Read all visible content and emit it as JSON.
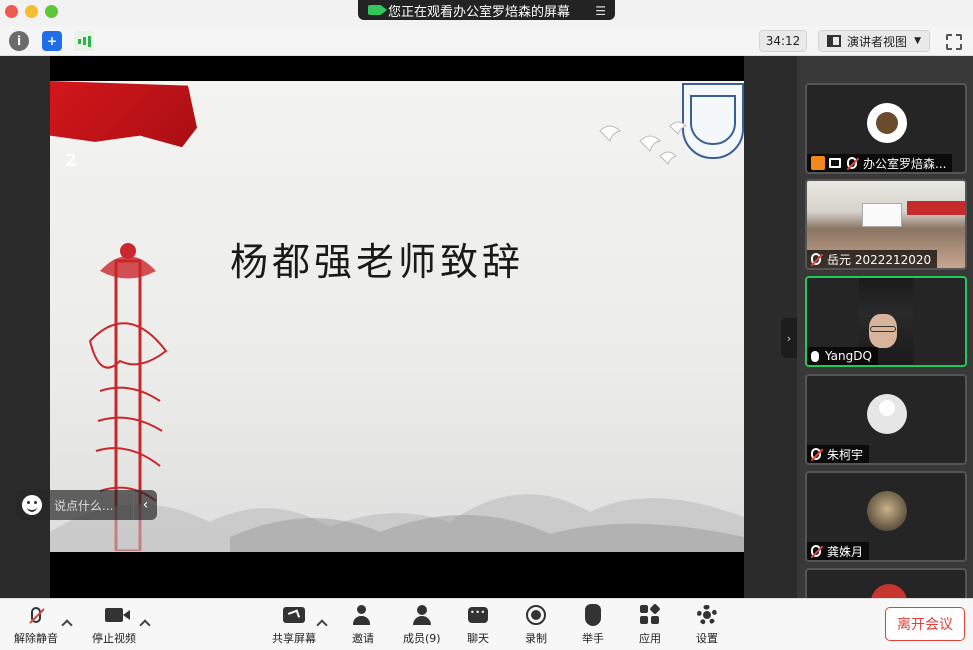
{
  "window": {
    "sharing_banner": "您正在观看办公室罗焙森的屏幕"
  },
  "topbar": {
    "timer": "34:12",
    "view_mode": "演讲者视图"
  },
  "slide": {
    "page_number": "2",
    "title": "杨都强老师致辞"
  },
  "chat_overlay": {
    "placeholder": "说点什么..."
  },
  "participants": [
    {
      "name": "办公室罗焙森...",
      "muted": true,
      "sharing": true
    },
    {
      "name": "岳元 2022212020",
      "muted": true
    },
    {
      "name": "YangDQ",
      "muted": false,
      "active_speaker": true
    },
    {
      "name": "朱柯宇",
      "muted": true
    },
    {
      "name": "龚姝月",
      "muted": true
    }
  ],
  "bottombar": {
    "unmute": "解除静音",
    "stop_video": "停止视频",
    "share_screen": "共享屏幕",
    "invite": "邀请",
    "members": "成员(9)",
    "chat": "聊天",
    "record": "录制",
    "raise_hand": "举手",
    "apps": "应用",
    "settings": "设置",
    "leave": "离开会议"
  },
  "colors": {
    "accent_green": "#23c85d",
    "leave_red": "#e0413a",
    "flag_red": "#d2171c"
  }
}
